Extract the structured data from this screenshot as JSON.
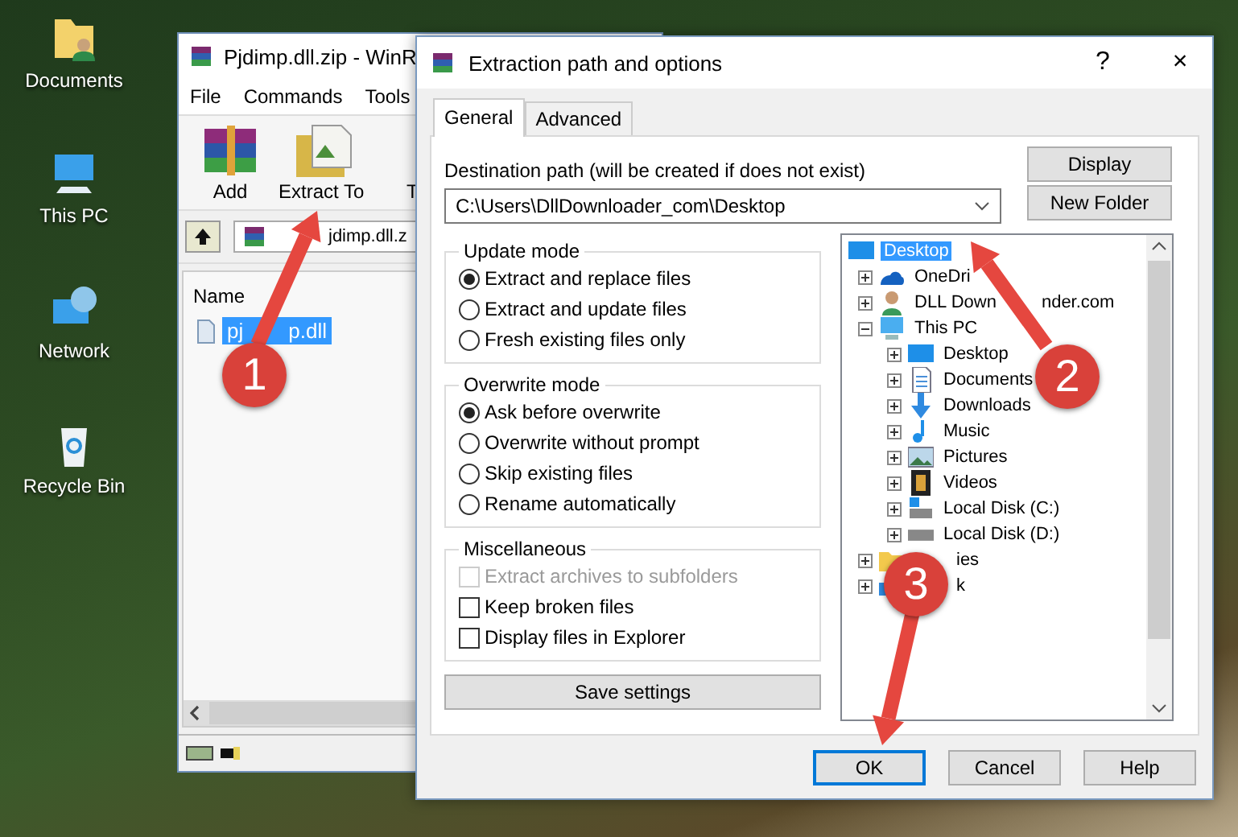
{
  "desktop_icons": [
    {
      "kind": "folder",
      "label": "Documents"
    },
    {
      "kind": "pc",
      "label": "This PC"
    },
    {
      "kind": "network",
      "label": "Network"
    },
    {
      "kind": "bin",
      "label": "Recycle Bin"
    }
  ],
  "archive_window": {
    "title": "Pjdimp.dll.zip - WinR",
    "menu": [
      "File",
      "Commands",
      "Tools"
    ],
    "toolbar": [
      {
        "kind": "add",
        "label": "Add"
      },
      {
        "kind": "extract",
        "label": "Extract To"
      },
      {
        "kind": "test",
        "label": "T"
      }
    ],
    "address": "jdimp.dll.z",
    "columns": [
      "Name"
    ],
    "files": [
      {
        "name": "pj",
        "name_tail": "p.dll",
        "selected": true
      }
    ]
  },
  "dialog": {
    "title": "Extraction path and options",
    "help": "?",
    "close": "×",
    "tabs": [
      {
        "label": "General",
        "selected": true
      },
      {
        "label": "Advanced",
        "selected": false
      }
    ],
    "destination_label": "Destination path (will be created if does not exist)",
    "destination_path": "C:\\Users\\DllDownloader_com\\Desktop",
    "side_buttons": [
      "Display",
      "New Folder"
    ],
    "update_mode": {
      "title": "Update mode",
      "options": [
        {
          "label": "Extract and replace files",
          "selected": true
        },
        {
          "label": "Extract and update files",
          "selected": false
        },
        {
          "label": "Fresh existing files only",
          "selected": false
        }
      ]
    },
    "overwrite_mode": {
      "title": "Overwrite mode",
      "options": [
        {
          "label": "Ask before overwrite",
          "selected": true
        },
        {
          "label": "Overwrite without prompt",
          "selected": false
        },
        {
          "label": "Skip existing files",
          "selected": false
        },
        {
          "label": "Rename automatically",
          "selected": false
        }
      ]
    },
    "miscellaneous": {
      "title": "Miscellaneous",
      "options": [
        {
          "label": "Extract archives to subfolders",
          "checked": false,
          "disabled": true
        },
        {
          "label": "Keep broken files",
          "checked": false,
          "disabled": false
        },
        {
          "label": "Display files in Explorer",
          "checked": false,
          "disabled": false
        }
      ]
    },
    "save_button": "Save settings",
    "tree": {
      "kind": "desktop",
      "label": "Desktop",
      "selected": true,
      "children": [
        {
          "kind": "cloud",
          "label": "OneDri",
          "selected": false,
          "expanded": false
        },
        {
          "kind": "user",
          "label": "DLL Down",
          "label_tail": "nder.com",
          "selected": false,
          "expanded": false
        },
        {
          "kind": "pc",
          "label": "This PC",
          "selected": false,
          "expanded": true,
          "children": [
            {
              "kind": "desktop",
              "label": "Desktop",
              "selected": false,
              "expanded": false
            },
            {
              "kind": "documents",
              "label": "Documents",
              "selected": false,
              "expanded": false
            },
            {
              "kind": "downloads",
              "label": "Downloads",
              "selected": false,
              "expanded": false
            },
            {
              "kind": "music",
              "label": "Music",
              "selected": false,
              "expanded": false
            },
            {
              "kind": "pictures",
              "label": "Pictures",
              "selected": false,
              "expanded": false
            },
            {
              "kind": "videos",
              "label": "Videos",
              "selected": false,
              "expanded": false
            },
            {
              "kind": "disk_c",
              "label": "Local Disk (C:)",
              "selected": false,
              "expanded": false
            },
            {
              "kind": "disk",
              "label": "Local Disk (D:)",
              "selected": false,
              "expanded": false
            }
          ]
        },
        {
          "kind": "libraries",
          "label_tail": "ies",
          "selected": false,
          "expanded": false
        },
        {
          "kind": "network",
          "label_tail": "k",
          "selected": false,
          "expanded": false
        }
      ]
    },
    "buttons": [
      {
        "label": "OK",
        "selected": true
      },
      {
        "label": "Cancel",
        "selected": false
      },
      {
        "label": "Help",
        "selected": false
      }
    ]
  },
  "steps": [
    {
      "number": "1"
    },
    {
      "number": "2"
    },
    {
      "number": "3"
    }
  ]
}
